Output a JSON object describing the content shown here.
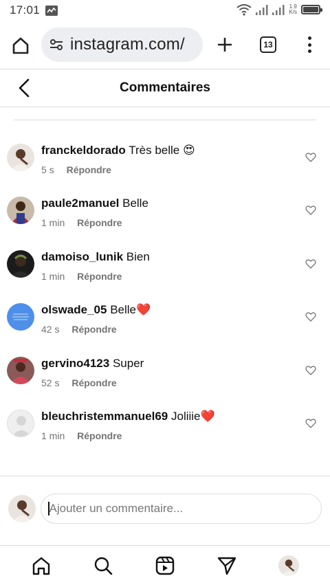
{
  "status_bar": {
    "time": "17:01",
    "net_speed_value": "1.9",
    "net_speed_unit": "K/s",
    "activity_icon": "activity-graph-icon",
    "wifi_icon": "wifi-icon",
    "signal_icon": "signal-bars-icon",
    "battery_icon": "battery-icon"
  },
  "browser": {
    "url": "instagram.com/",
    "tab_count": "13",
    "home_icon": "home-icon",
    "site_settings_icon": "tune-icon",
    "new_tab_icon": "plus-icon",
    "menu_icon": "more-vertical-icon"
  },
  "header": {
    "title": "Commentaires",
    "back_icon": "chevron-left-icon"
  },
  "comments": [
    {
      "username": "franckeldorado",
      "text": "Très belle 😍",
      "time": "5 s",
      "reply_label": "Répondre"
    },
    {
      "username": "paule2manuel",
      "text": "Belle",
      "time": "1 min",
      "reply_label": "Répondre"
    },
    {
      "username": "damoiso_lunik",
      "text": "Bien",
      "time": "1 min",
      "reply_label": "Répondre"
    },
    {
      "username": "olswade_05",
      "text": "Belle❤️",
      "time": "42 s",
      "reply_label": "Répondre"
    },
    {
      "username": "gervino4123",
      "text": "Super",
      "time": "52 s",
      "reply_label": "Répondre"
    },
    {
      "username": "bleuchristemmanuel69",
      "text": "Joliiie❤️",
      "time": "1 min",
      "reply_label": "Répondre"
    }
  ],
  "add_comment": {
    "placeholder": "Ajouter un commentaire..."
  },
  "bottom_nav": {
    "items": [
      "home-icon",
      "search-icon",
      "reels-icon",
      "direct-message-icon",
      "profile-avatar"
    ]
  },
  "colors": {
    "text": "#111111",
    "secondary_text": "#737373",
    "divider": "#dbdbdb",
    "url_pill": "#edeef1",
    "olswade_avatar": "#4e8fea",
    "heart": "#e0245e"
  }
}
